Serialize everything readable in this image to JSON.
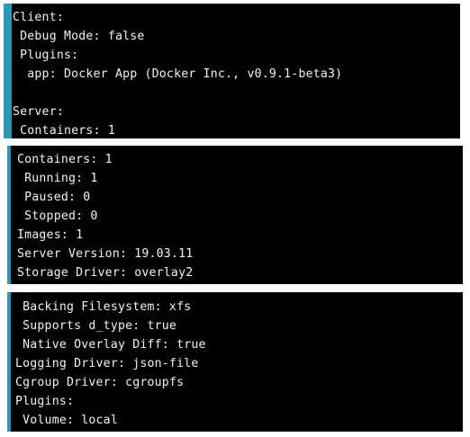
{
  "panels": [
    {
      "lines": [
        "Client:",
        " Debug Mode: false",
        " Plugins:",
        "  app: Docker App (Docker Inc., v0.9.1-beta3)",
        "",
        "Server:",
        " Containers: 1"
      ]
    },
    {
      "lines": [
        "Containers: 1",
        " Running: 1",
        " Paused: 0",
        " Stopped: 0",
        "Images: 1",
        "Server Version: 19.03.11",
        "Storage Driver: overlay2"
      ]
    },
    {
      "lines": [
        " Backing Filesystem: xfs",
        " Supports d_type: true",
        " Native Overlay Diff: true",
        "Logging Driver: json-file",
        "Cgroup Driver: cgroupfs",
        "Plugins:",
        " Volume: local"
      ]
    }
  ],
  "colors": {
    "terminal_bg": "#000000",
    "terminal_text": "#f2f2f2",
    "accent_bar": "#2c98b6"
  }
}
